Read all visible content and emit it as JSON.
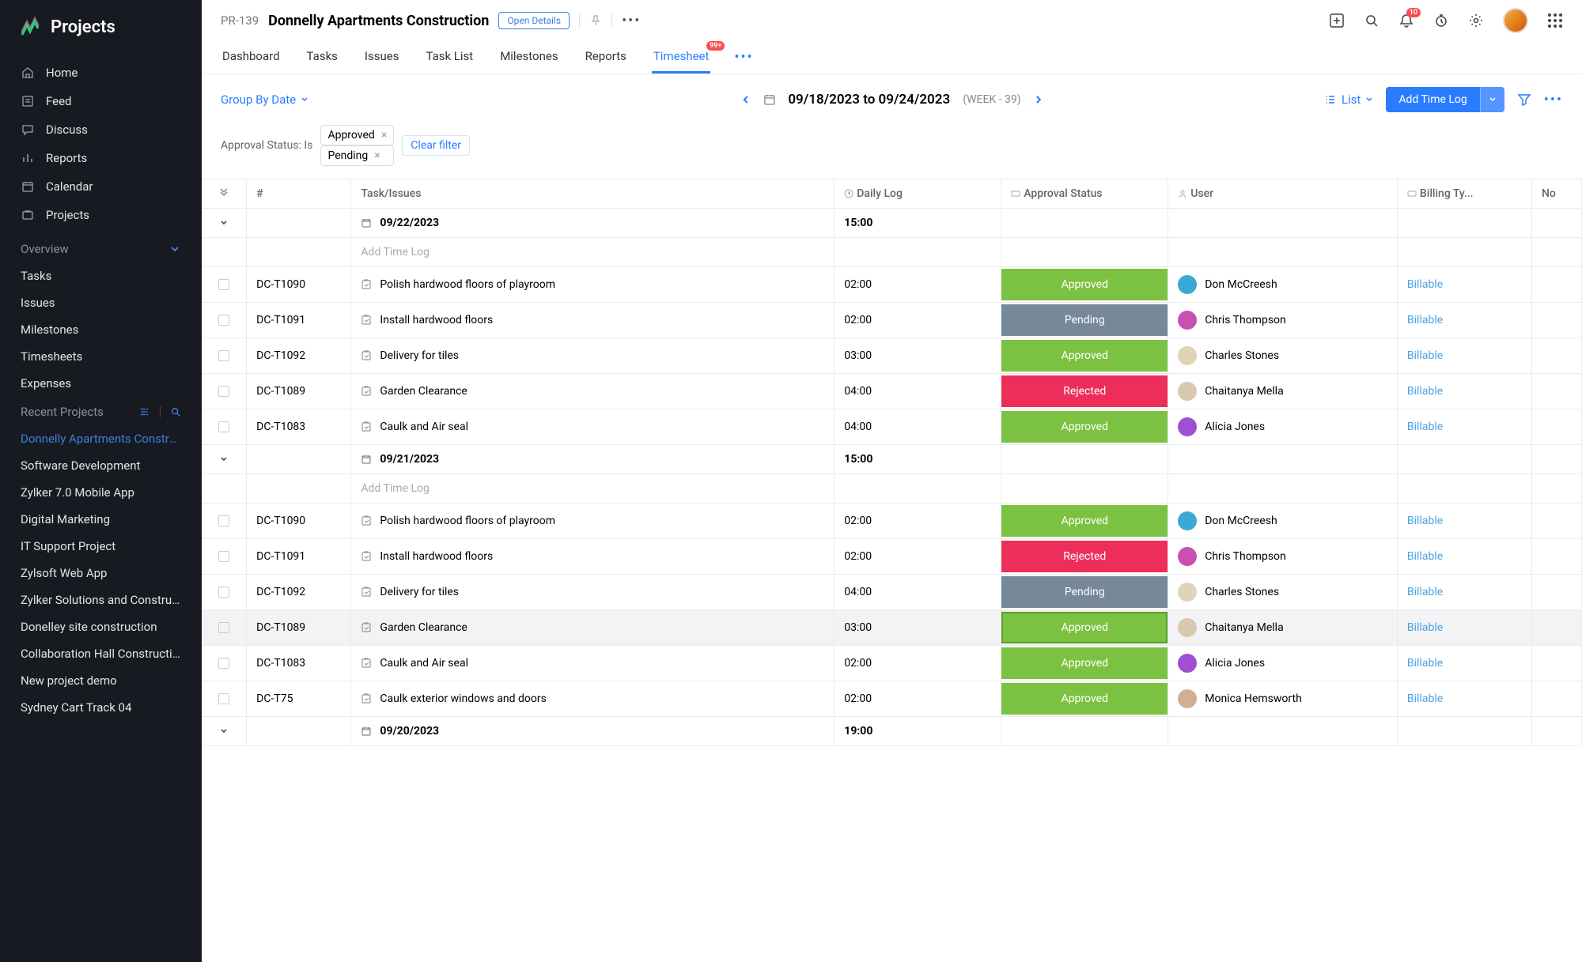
{
  "app": {
    "name": "Projects"
  },
  "sidebar": {
    "nav": [
      {
        "label": "Home",
        "icon": "home"
      },
      {
        "label": "Feed",
        "icon": "feed"
      },
      {
        "label": "Discuss",
        "icon": "discuss"
      },
      {
        "label": "Reports",
        "icon": "reports"
      },
      {
        "label": "Calendar",
        "icon": "calendar"
      },
      {
        "label": "Projects",
        "icon": "projects"
      }
    ],
    "overview_label": "Overview",
    "overview": [
      {
        "label": "Tasks"
      },
      {
        "label": "Issues"
      },
      {
        "label": "Milestones"
      },
      {
        "label": "Timesheets"
      },
      {
        "label": "Expenses"
      }
    ],
    "recent_label": "Recent Projects",
    "recent": [
      {
        "label": "Donnelly Apartments Construction",
        "active": true
      },
      {
        "label": "Software Development"
      },
      {
        "label": "Zylker 7.0 Mobile App"
      },
      {
        "label": "Digital Marketing"
      },
      {
        "label": "IT Support Project"
      },
      {
        "label": "Zylsoft Web App"
      },
      {
        "label": "Zylker Solutions and Constructions"
      },
      {
        "label": "Donelley site construction"
      },
      {
        "label": "Collaboration Hall Construction"
      },
      {
        "label": "New project demo"
      },
      {
        "label": "Sydney Cart Track 04"
      }
    ]
  },
  "header": {
    "project_code": "PR-139",
    "project_title": "Donnelly Apartments Construction",
    "open_details": "Open Details",
    "notification_badge": "10",
    "tabs": [
      {
        "label": "Dashboard"
      },
      {
        "label": "Tasks"
      },
      {
        "label": "Issues"
      },
      {
        "label": "Task List"
      },
      {
        "label": "Milestones"
      },
      {
        "label": "Reports"
      },
      {
        "label": "Timesheet",
        "active": true,
        "badge": "99+"
      }
    ]
  },
  "toolbar": {
    "group_by": "Group By Date",
    "date_range": "09/18/2023 to 09/24/2023",
    "week_label": "(WEEK - 39)",
    "list_label": "List",
    "add_time_log": "Add Time Log"
  },
  "filters": {
    "label": "Approval Status: Is",
    "chips": [
      "Approved",
      "Pending"
    ],
    "clear": "Clear filter"
  },
  "table": {
    "headers": {
      "hash": "#",
      "task": "Task/Issues",
      "daily": "Daily Log",
      "status": "Approval Status",
      "user": "User",
      "billing": "Billing Ty...",
      "none": "No"
    },
    "add_time_log": "Add Time Log",
    "groups": [
      {
        "date": "09/22/2023",
        "total": "15:00",
        "rows": [
          {
            "id": "DC-T1090",
            "task": "Polish hardwood floors of playroom",
            "daily": "02:00",
            "status": "Approved",
            "user": "Don McCreesh",
            "avatar": "#3ba9d4",
            "billing": "Billable"
          },
          {
            "id": "DC-T1091",
            "task": "Install hardwood floors",
            "daily": "02:00",
            "status": "Pending",
            "user": "Chris Thompson",
            "avatar": "#c94fb1",
            "billing": "Billable"
          },
          {
            "id": "DC-T1092",
            "task": "Delivery for tiles",
            "daily": "03:00",
            "status": "Approved",
            "user": "Charles Stones",
            "avatar": "#e0d4b8",
            "billing": "Billable"
          },
          {
            "id": "DC-T1089",
            "task": "Garden Clearance",
            "daily": "04:00",
            "status": "Rejected",
            "user": "Chaitanya Mella",
            "avatar": "#d8c8b0",
            "billing": "Billable"
          },
          {
            "id": "DC-T1083",
            "task": "Caulk and Air seal",
            "daily": "04:00",
            "status": "Approved",
            "user": "Alicia Jones",
            "avatar": "#a04fd4",
            "billing": "Billable"
          }
        ]
      },
      {
        "date": "09/21/2023",
        "total": "15:00",
        "rows": [
          {
            "id": "DC-T1090",
            "task": "Polish hardwood floors of playroom",
            "daily": "02:00",
            "status": "Approved",
            "user": "Don McCreesh",
            "avatar": "#3ba9d4",
            "billing": "Billable"
          },
          {
            "id": "DC-T1091",
            "task": "Install hardwood floors",
            "daily": "02:00",
            "status": "Rejected",
            "user": "Chris Thompson",
            "avatar": "#c94fb1",
            "billing": "Billable"
          },
          {
            "id": "DC-T1092",
            "task": "Delivery for tiles",
            "daily": "04:00",
            "status": "Pending",
            "user": "Charles Stones",
            "avatar": "#e0d4b8",
            "billing": "Billable"
          },
          {
            "id": "DC-T1089",
            "task": "Garden Clearance",
            "daily": "03:00",
            "status": "Approved",
            "user": "Chaitanya Mella",
            "avatar": "#d8c8b0",
            "billing": "Billable",
            "highlighted": true
          },
          {
            "id": "DC-T1083",
            "task": "Caulk and Air seal",
            "daily": "02:00",
            "status": "Approved",
            "user": "Alicia Jones",
            "avatar": "#a04fd4",
            "billing": "Billable"
          },
          {
            "id": "DC-T75",
            "task": "Caulk exterior windows and doors",
            "daily": "02:00",
            "status": "Approved",
            "user": "Monica Hemsworth",
            "avatar": "#d0b090",
            "billing": "Billable"
          }
        ]
      },
      {
        "date": "09/20/2023",
        "total": "19:00",
        "rows": []
      }
    ]
  }
}
